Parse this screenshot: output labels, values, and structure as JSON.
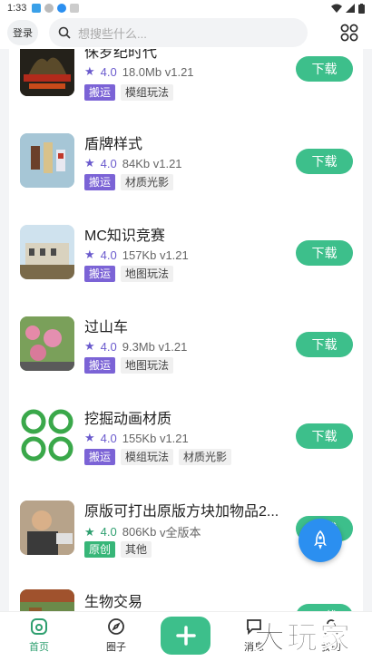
{
  "status_bar": {
    "time": "1:33"
  },
  "header": {
    "login_label": "登录",
    "search_placeholder": "想搜些什么...",
    "grid_icon": "grid-icon"
  },
  "items": [
    {
      "title": "侏罗纪时代",
      "rating": "4.0",
      "size": "18.0Mb",
      "version": "v1.21",
      "tags": [
        "搬运",
        "模组玩法"
      ],
      "action": "下载"
    },
    {
      "title": "盾牌样式",
      "rating": "4.0",
      "size": "84Kb",
      "version": "v1.21",
      "tags": [
        "搬运",
        "材质光影"
      ],
      "action": "下载"
    },
    {
      "title": "MC知识竞赛",
      "rating": "4.0",
      "size": "157Kb",
      "version": "v1.21",
      "tags": [
        "搬运",
        "地图玩法"
      ],
      "action": "下载"
    },
    {
      "title": "过山车",
      "rating": "4.0",
      "size": "9.3Mb",
      "version": "v1.21",
      "tags": [
        "搬运",
        "地图玩法"
      ],
      "action": "下载"
    },
    {
      "title": "挖掘动画材质",
      "rating": "4.0",
      "size": "155Kb",
      "version": "v1.21",
      "tags": [
        "搬运",
        "模组玩法",
        "材质光影"
      ],
      "action": "下载"
    },
    {
      "title": "原版可打出原版方块加物品2...",
      "rating": "4.0",
      "size": "806Kb",
      "version": "v全版本",
      "tags": [
        "原创",
        "其他"
      ],
      "action": "下载"
    },
    {
      "title": "生物交易",
      "rating": "",
      "size": "",
      "version": "",
      "tags": [],
      "action": "下载"
    }
  ],
  "tabbar": {
    "home": "首页",
    "circle": "圈子",
    "messages": "消息",
    "mine": "我的"
  },
  "watermark": "大玩家",
  "colors": {
    "accent": "#3dbf8b",
    "tag_purple": "#7b63d6",
    "fab_blue": "#2b8ff0"
  }
}
